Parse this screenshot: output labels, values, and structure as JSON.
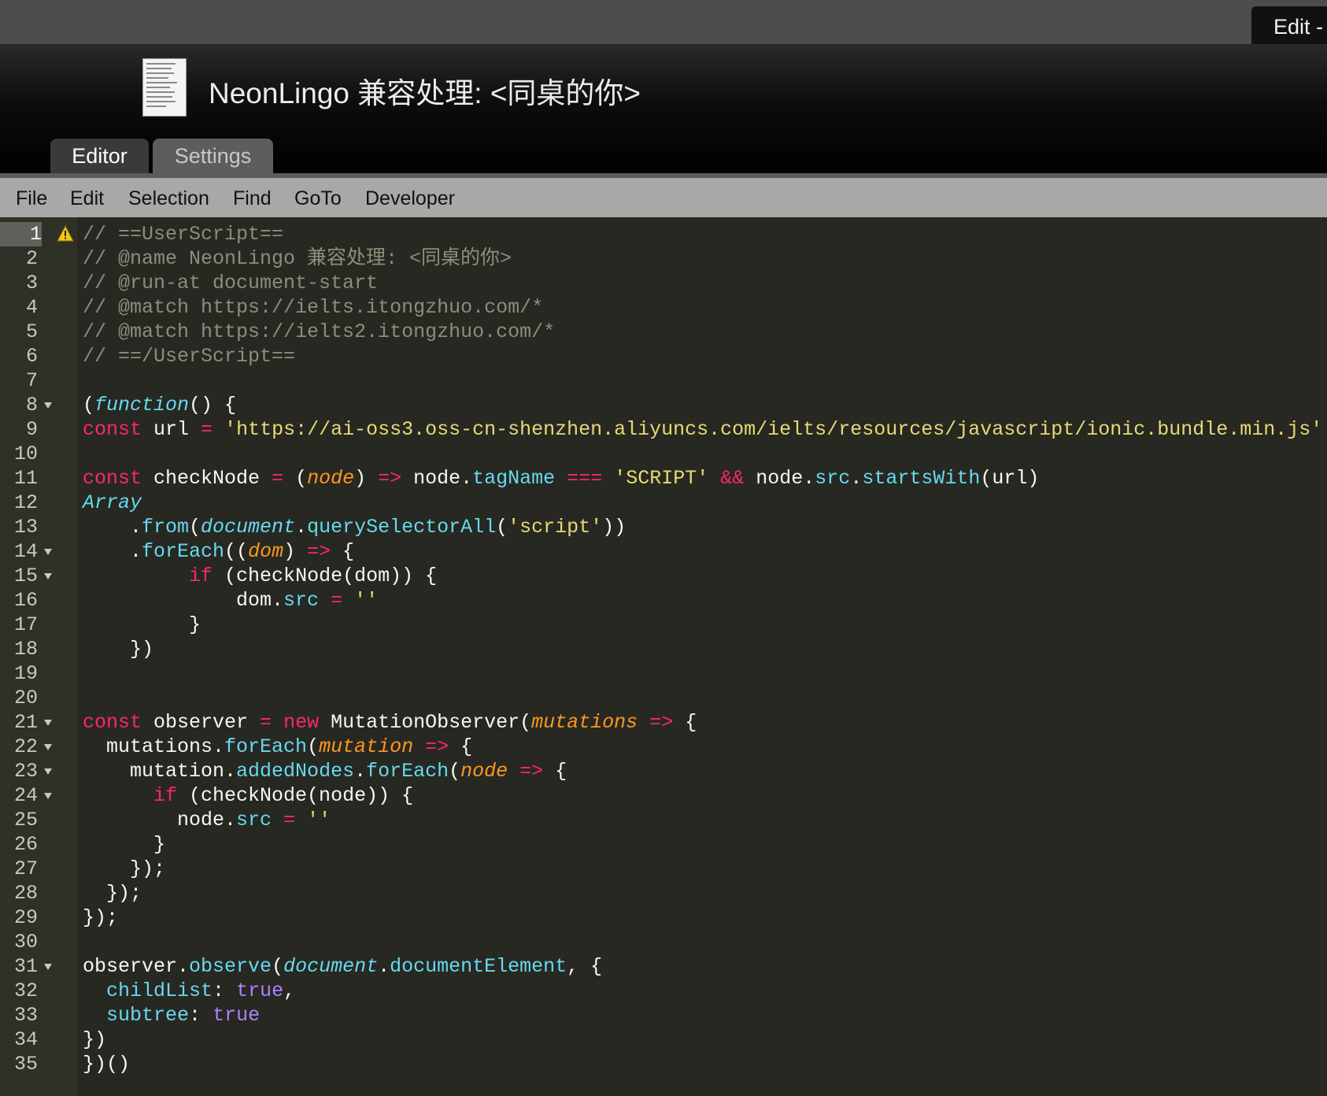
{
  "browser_tab": {
    "label": "Edit - "
  },
  "header": {
    "title": "NeonLingo 兼容处理: <同桌的你>",
    "icon": "script-document-icon"
  },
  "tabs": [
    {
      "label": "Editor",
      "active": true
    },
    {
      "label": "Settings",
      "active": false
    }
  ],
  "menu": [
    "File",
    "Edit",
    "Selection",
    "Find",
    "GoTo",
    "Developer"
  ],
  "editor": {
    "active_line": 1,
    "warning_line": 1,
    "fold_lines": [
      8,
      14,
      15,
      21,
      22,
      23,
      24,
      31
    ],
    "line_numbers": [
      "1",
      "2",
      "3",
      "4",
      "5",
      "6",
      "7",
      "8",
      "9",
      "10",
      "11",
      "12",
      "13",
      "14",
      "15",
      "16",
      "17",
      "18",
      "19",
      "20",
      "21",
      "22",
      "23",
      "24",
      "25",
      "26",
      "27",
      "28",
      "29",
      "30",
      "31",
      "32",
      "33",
      "34",
      "35"
    ],
    "lines": [
      [
        [
          "// ==UserScript==",
          "cm"
        ]
      ],
      [
        [
          "// @name NeonLingo 兼容处理: <同桌的你>",
          "cm"
        ]
      ],
      [
        [
          "// @run-at document-start",
          "cm"
        ]
      ],
      [
        [
          "// @match https://ielts.itongzhuo.com/*",
          "cm"
        ]
      ],
      [
        [
          "// @match https://ielts2.itongzhuo.com/*",
          "cm"
        ]
      ],
      [
        [
          "// ==/UserScript==",
          "cm"
        ]
      ],
      [],
      [
        [
          "(",
          ""
        ],
        [
          "function",
          "it"
        ],
        [
          "() {",
          ""
        ]
      ],
      [
        [
          "const",
          "kw"
        ],
        [
          " url ",
          ""
        ],
        [
          "=",
          "kw"
        ],
        [
          " ",
          ""
        ],
        [
          "'https://ai-oss3.oss-cn-shenzhen.aliyuncs.com/ielts/resources/javascript/ionic.bundle.min.js'",
          "str"
        ]
      ],
      [],
      [
        [
          "const",
          "kw"
        ],
        [
          " checkNode ",
          ""
        ],
        [
          "=",
          "kw"
        ],
        [
          " (",
          ""
        ],
        [
          "node",
          "pa"
        ],
        [
          ") ",
          ""
        ],
        [
          "=>",
          "kw"
        ],
        [
          " node.",
          ""
        ],
        [
          "tagName",
          "fn"
        ],
        [
          " ",
          ""
        ],
        [
          "===",
          "kw"
        ],
        [
          " ",
          ""
        ],
        [
          "'SCRIPT'",
          "str"
        ],
        [
          " ",
          ""
        ],
        [
          "&&",
          "kw"
        ],
        [
          " node.",
          ""
        ],
        [
          "src",
          "fn"
        ],
        [
          ".",
          ""
        ],
        [
          "startsWith",
          "fn"
        ],
        [
          "(url)",
          ""
        ]
      ],
      [
        [
          "Array",
          "it"
        ]
      ],
      [
        [
          "    .",
          ""
        ],
        [
          "from",
          "fn"
        ],
        [
          "(",
          ""
        ],
        [
          "document",
          "it"
        ],
        [
          ".",
          ""
        ],
        [
          "querySelectorAll",
          "fn"
        ],
        [
          "(",
          ""
        ],
        [
          "'script'",
          "str"
        ],
        [
          "))",
          ""
        ]
      ],
      [
        [
          "    .",
          ""
        ],
        [
          "forEach",
          "fn"
        ],
        [
          "((",
          ""
        ],
        [
          "dom",
          "pa"
        ],
        [
          ") ",
          ""
        ],
        [
          "=>",
          "kw"
        ],
        [
          " {",
          ""
        ]
      ],
      [
        [
          "         ",
          ""
        ],
        [
          "if",
          "kw"
        ],
        [
          " (checkNode(dom)) {",
          ""
        ]
      ],
      [
        [
          "             dom.",
          ""
        ],
        [
          "src",
          "fn"
        ],
        [
          " ",
          ""
        ],
        [
          "=",
          "kw"
        ],
        [
          " ",
          ""
        ],
        [
          "''",
          "str"
        ]
      ],
      [
        [
          "         }",
          ""
        ]
      ],
      [
        [
          "    })",
          ""
        ]
      ],
      [],
      [],
      [
        [
          "const",
          "kw"
        ],
        [
          " observer ",
          ""
        ],
        [
          "=",
          "kw"
        ],
        [
          " ",
          ""
        ],
        [
          "new",
          "kw"
        ],
        [
          " MutationObserver(",
          ""
        ],
        [
          "mutations",
          "pa"
        ],
        [
          " ",
          ""
        ],
        [
          "=>",
          "kw"
        ],
        [
          " {",
          ""
        ]
      ],
      [
        [
          "  mutations.",
          ""
        ],
        [
          "forEach",
          "fn"
        ],
        [
          "(",
          ""
        ],
        [
          "mutation",
          "pa"
        ],
        [
          " ",
          ""
        ],
        [
          "=>",
          "kw"
        ],
        [
          " {",
          ""
        ]
      ],
      [
        [
          "    mutation.",
          ""
        ],
        [
          "addedNodes",
          "fn"
        ],
        [
          ".",
          ""
        ],
        [
          "forEach",
          "fn"
        ],
        [
          "(",
          ""
        ],
        [
          "node",
          "pa"
        ],
        [
          " ",
          ""
        ],
        [
          "=>",
          "kw"
        ],
        [
          " {",
          ""
        ]
      ],
      [
        [
          "      ",
          ""
        ],
        [
          "if",
          "kw"
        ],
        [
          " (checkNode(node)) {",
          ""
        ]
      ],
      [
        [
          "        node.",
          ""
        ],
        [
          "src",
          "fn"
        ],
        [
          " ",
          ""
        ],
        [
          "=",
          "kw"
        ],
        [
          " ",
          ""
        ],
        [
          "''",
          "str"
        ]
      ],
      [
        [
          "      }",
          ""
        ]
      ],
      [
        [
          "    });",
          ""
        ]
      ],
      [
        [
          "  });",
          ""
        ]
      ],
      [
        [
          "});",
          ""
        ]
      ],
      [],
      [
        [
          "observer.",
          ""
        ],
        [
          "observe",
          "fn"
        ],
        [
          "(",
          ""
        ],
        [
          "document",
          "it"
        ],
        [
          ".",
          ""
        ],
        [
          "documentElement",
          "fn"
        ],
        [
          ", {",
          ""
        ]
      ],
      [
        [
          "  ",
          ""
        ],
        [
          "childList",
          "fn"
        ],
        [
          ": ",
          ""
        ],
        [
          "true",
          "nu"
        ],
        [
          ",",
          ""
        ]
      ],
      [
        [
          "  ",
          ""
        ],
        [
          "subtree",
          "fn"
        ],
        [
          ": ",
          ""
        ],
        [
          "true",
          "nu"
        ]
      ],
      [
        [
          "})",
          ""
        ]
      ],
      [
        [
          "})()",
          ""
        ]
      ]
    ]
  }
}
